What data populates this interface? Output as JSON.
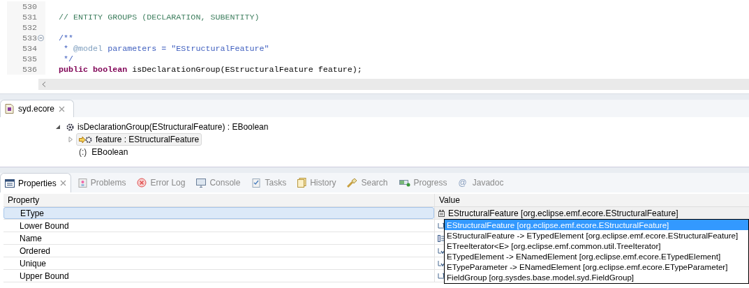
{
  "editor": {
    "lines": [
      {
        "number": "530",
        "fold": false
      },
      {
        "number": "531",
        "fold": false,
        "tokens": [
          {
            "kind": "comment",
            "text": "// ENTITY GROUPS (DECLARATION, SUBENTITY)"
          }
        ]
      },
      {
        "number": "532",
        "fold": false
      },
      {
        "number": "533",
        "fold": true,
        "tokens": [
          {
            "kind": "javadoc",
            "text": "/**"
          }
        ]
      },
      {
        "number": "534",
        "fold": false,
        "tokens": [
          {
            "kind": "javadoc",
            "text": " * "
          },
          {
            "kind": "tag",
            "text": "@model"
          },
          {
            "kind": "javadoc",
            "text": " parameters = \"EStructuralFeature\""
          }
        ]
      },
      {
        "number": "535",
        "fold": false,
        "tokens": [
          {
            "kind": "javadoc",
            "text": " */"
          }
        ]
      },
      {
        "number": "536",
        "fold": false,
        "tokens": [
          {
            "kind": "keyword",
            "text": "public"
          },
          {
            "kind": "keyword",
            "text": " boolean"
          },
          {
            "kind": "plain",
            "text": " isDeclarationGroup(EStructuralFeature feature);"
          }
        ]
      }
    ]
  },
  "model_editor": {
    "tab": {
      "label": "syd.ecore"
    },
    "tree": [
      {
        "kind": "operation",
        "label": "isDeclarationGroup(EStructuralFeature) : EBoolean",
        "expanded": true,
        "selected": false,
        "children": [
          {
            "kind": "parameter",
            "label": "feature : EStructuralFeature",
            "expanded": false,
            "selected": true
          },
          {
            "kind": "generic_type",
            "glyph": "(:)",
            "label": "EBoolean",
            "selected": false
          }
        ]
      }
    ]
  },
  "properties": {
    "tabs": [
      {
        "kind": "properties",
        "label": "Properties",
        "selected": true
      },
      {
        "kind": "problems",
        "label": "Problems",
        "selected": false
      },
      {
        "kind": "error_log",
        "label": "Error Log",
        "selected": false
      },
      {
        "kind": "console",
        "label": "Console",
        "selected": false
      },
      {
        "kind": "tasks",
        "label": "Tasks",
        "selected": false
      },
      {
        "kind": "history",
        "label": "History",
        "selected": false
      },
      {
        "kind": "search",
        "label": "Search",
        "selected": false
      },
      {
        "kind": "progress",
        "label": "Progress",
        "selected": false
      },
      {
        "kind": "javadoc",
        "glyph": "@",
        "label": "Javadoc",
        "selected": false
      }
    ],
    "columns": [
      "Property",
      "Value"
    ],
    "rows": [
      {
        "kind": "type",
        "property": "EType",
        "value": "EStructuralFeature [org.eclipse.emf.ecore.EStructuralFeature]",
        "selected": true
      },
      {
        "kind": "number",
        "property": "Lower Bound",
        "selected": false
      },
      {
        "kind": "text",
        "property": "Name",
        "selected": false
      },
      {
        "kind": "boolean",
        "property": "Ordered",
        "selected": false
      },
      {
        "kind": "boolean",
        "property": "Unique",
        "selected": false
      },
      {
        "kind": "number",
        "property": "Upper Bound",
        "selected": false
      }
    ],
    "dropdown": {
      "items": [
        {
          "label": "EStructuralFeature [org.eclipse.emf.ecore.EStructuralFeature]",
          "selected": true
        },
        {
          "label": "EStructuralFeature -> ETypedElement [org.eclipse.emf.ecore.EStructuralFeature]",
          "selected": false
        },
        {
          "label": "ETreeIterator<E> [org.eclipse.emf.common.util.TreeIterator]",
          "selected": false
        },
        {
          "label": "ETypedElement -> ENamedElement [org.eclipse.emf.ecore.ETypedElement]",
          "selected": false
        },
        {
          "label": "ETypeParameter -> ENamedElement [org.eclipse.emf.ecore.ETypeParameter]",
          "selected": false
        },
        {
          "label": "FieldGroup [org.sysdes.base.model.syd.FieldGroup]",
          "selected": false
        }
      ]
    }
  }
}
